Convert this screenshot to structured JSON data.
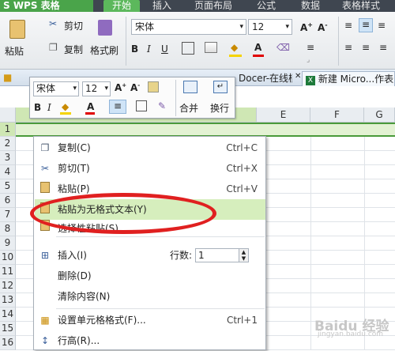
{
  "app": {
    "logo": "S WPS 表格",
    "menu_tabs": [
      "开始",
      "插入",
      "页面布局",
      "公式",
      "数据",
      "表格样式"
    ]
  },
  "ribbon": {
    "paste_label": "粘贴",
    "cut_label": "剪切",
    "copy_label": "复制",
    "format_painter_label": "格式刷",
    "font_name": "宋体",
    "font_size": "12"
  },
  "doc_tabs": [
    "Docer-在线模板",
    "新建 Micro...作表.x"
  ],
  "float_toolbar": {
    "font_name": "宋体",
    "font_size": "12",
    "merge_label": "合并",
    "wrap_label": "换行"
  },
  "sheet": {
    "columns": [
      "E",
      "F",
      "G"
    ],
    "rows": [
      "1",
      "2",
      "3",
      "4",
      "5",
      "6",
      "7",
      "8",
      "9",
      "10",
      "11",
      "12",
      "13",
      "14",
      "15",
      "16"
    ]
  },
  "context_menu": {
    "items": [
      {
        "icon": "copy-icon",
        "label": "复制(C)",
        "shortcut": "Ctrl+C"
      },
      {
        "icon": "scissors-icon",
        "label": "剪切(T)",
        "shortcut": "Ctrl+X"
      },
      {
        "icon": "paste-icon",
        "label": "粘贴(P)",
        "shortcut": "Ctrl+V"
      },
      {
        "icon": "paste-text-icon",
        "label": "粘贴为无格式文本(Y)",
        "shortcut": ""
      },
      {
        "icon": "paste-special-icon",
        "label": "选择性粘贴(S)...",
        "shortcut": ""
      },
      {
        "icon": "insert-icon",
        "label": "插入(I)",
        "shortcut": ""
      },
      {
        "icon": "",
        "label": "删除(D)",
        "shortcut": ""
      },
      {
        "icon": "",
        "label": "清除内容(N)",
        "shortcut": ""
      },
      {
        "icon": "format-cells-icon",
        "label": "设置单元格格式(F)...",
        "shortcut": "Ctrl+1"
      },
      {
        "icon": "row-height-icon",
        "label": "行高(R)...",
        "shortcut": ""
      }
    ],
    "row_count_label": "行数:",
    "row_count_value": "1",
    "highlighted_item": "粘贴为无格式文本(Y)"
  },
  "watermark": "Baidu 经验",
  "watermark_sub": "jingyan.baidu.com",
  "colors": {
    "accent_green": "#5cb85c",
    "highlight": "#d6eebd",
    "annotation_red": "#e02020"
  }
}
